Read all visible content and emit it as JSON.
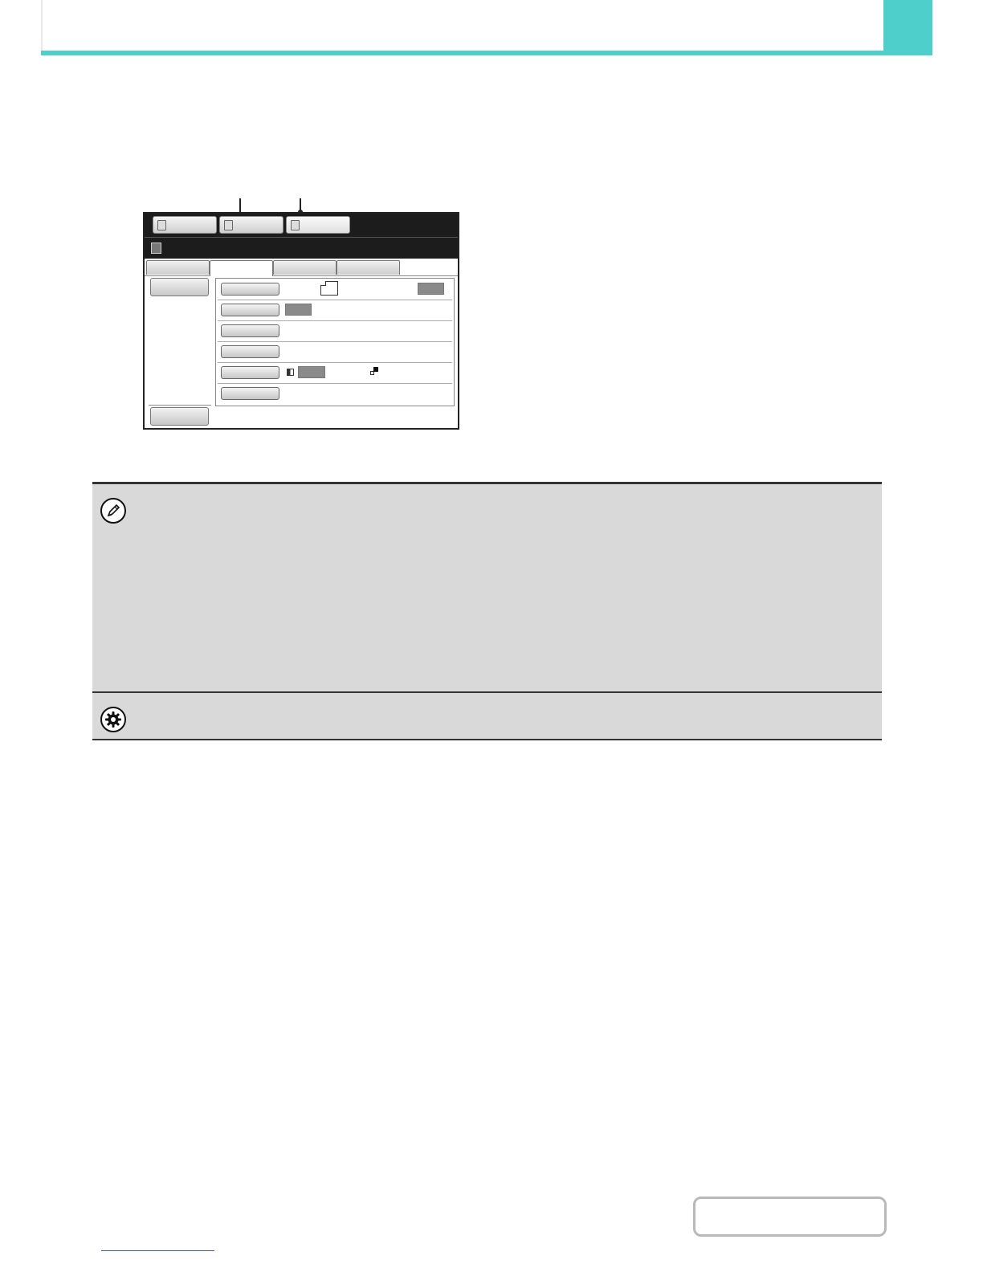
{
  "header": {
    "page_tab_label": "",
    "accent_color": "#4ecfcc"
  },
  "ui_panel": {
    "mode_buttons": [
      {
        "label": ""
      },
      {
        "label": ""
      },
      {
        "label": ""
      }
    ],
    "title": "",
    "tabs": [
      {
        "label": ""
      },
      {
        "label": ""
      },
      {
        "label": ""
      },
      {
        "label": ""
      }
    ],
    "left_buttons": [
      {
        "label": ""
      },
      {
        "label": ""
      }
    ],
    "rows": [
      {
        "button_label": "",
        "value": ""
      },
      {
        "button_label": "",
        "value": ""
      },
      {
        "button_label": "",
        "value": ""
      },
      {
        "button_label": "",
        "value": ""
      },
      {
        "button_label": "",
        "value": ""
      },
      {
        "button_label": "",
        "value": ""
      }
    ]
  },
  "note_box": {
    "note_icon": "pencil-icon",
    "settings_icon": "gear-icon",
    "background_color": "#d9d9d9"
  },
  "nav": {
    "contents_label": ""
  }
}
